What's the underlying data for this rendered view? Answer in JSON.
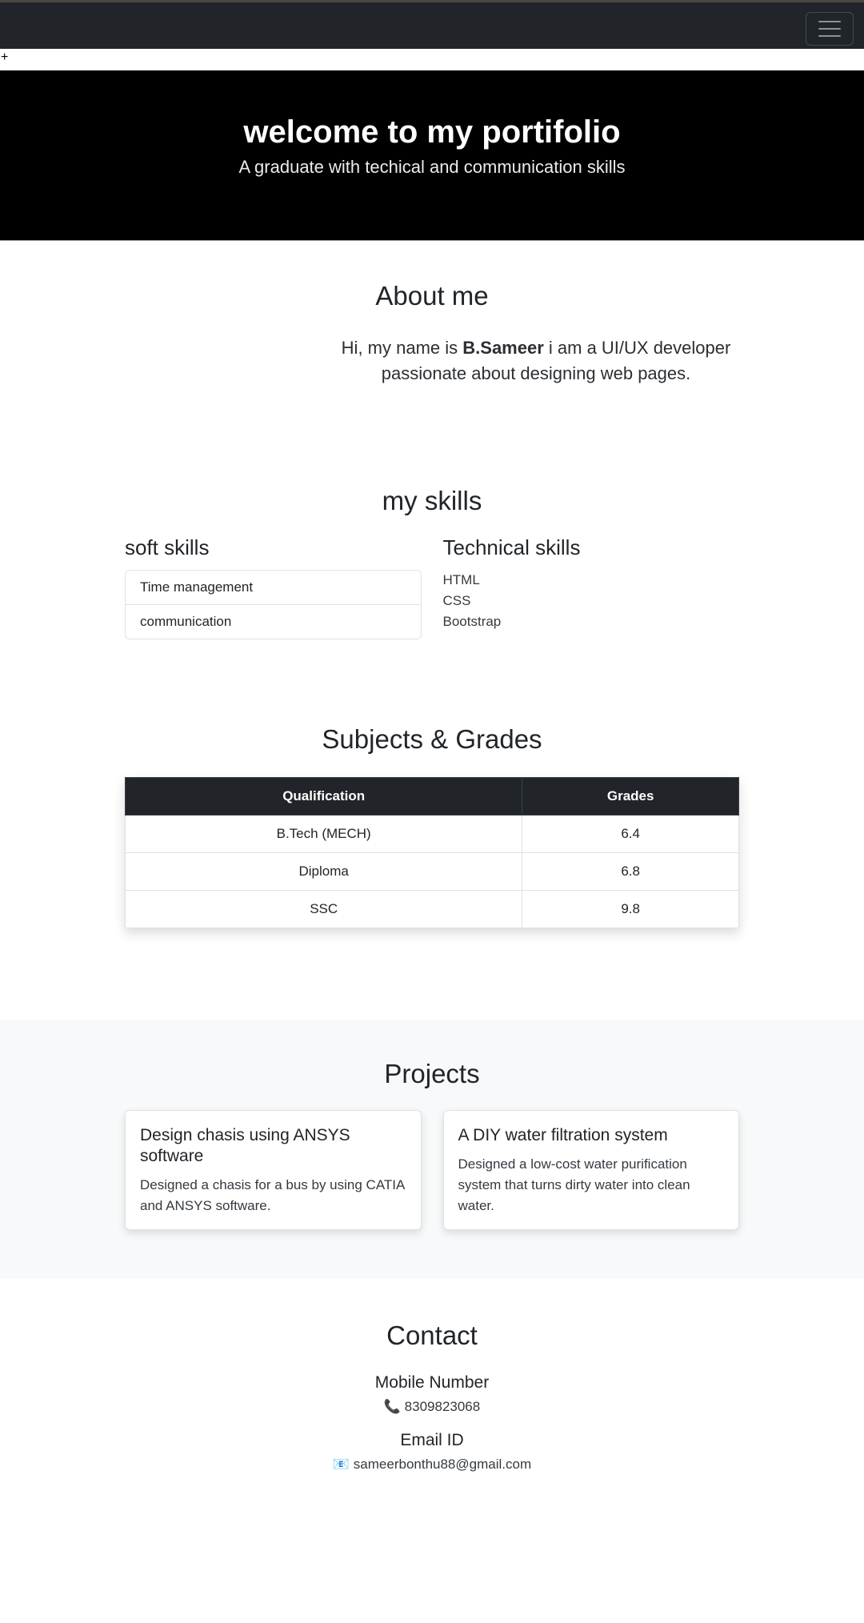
{
  "navbar": {
    "stray_text": "+"
  },
  "hero": {
    "title": "welcome to my portifolio",
    "subtitle": "A graduate with techical and communication skills"
  },
  "about": {
    "heading": "About me",
    "text_before": "Hi, my name is ",
    "name": "B.Sameer",
    "text_after": " i am a UI/UX developer passionate about designing web pages."
  },
  "skills": {
    "heading": "my skills",
    "soft": {
      "title": "soft skills",
      "items": [
        "Time management",
        "communication"
      ]
    },
    "technical": {
      "title": "Technical skills",
      "items": [
        "HTML",
        "CSS",
        "Bootstrap"
      ]
    }
  },
  "grades": {
    "heading": "Subjects & Grades",
    "columns": [
      "Qualification",
      "Grades"
    ],
    "rows": [
      [
        "B.Tech (MECH)",
        "6.4"
      ],
      [
        "Diploma",
        "6.8"
      ],
      [
        "SSC",
        "9.8"
      ]
    ]
  },
  "projects": {
    "heading": "Projects",
    "items": [
      {
        "title": "Design chasis using ANSYS software",
        "description": "Designed a chasis for a bus by using CATIA and ANSYS software."
      },
      {
        "title": "A DIY water filtration system",
        "description": "Designed a low-cost water purification system that turns dirty water into clean water."
      }
    ]
  },
  "contact": {
    "heading": "Contact",
    "mobile_label": "Mobile Number",
    "mobile_icon": "📞",
    "mobile": "8309823068",
    "email_label": "Email ID",
    "email_icon": "📧",
    "email": "sameerbonthu88@gmail.com"
  }
}
